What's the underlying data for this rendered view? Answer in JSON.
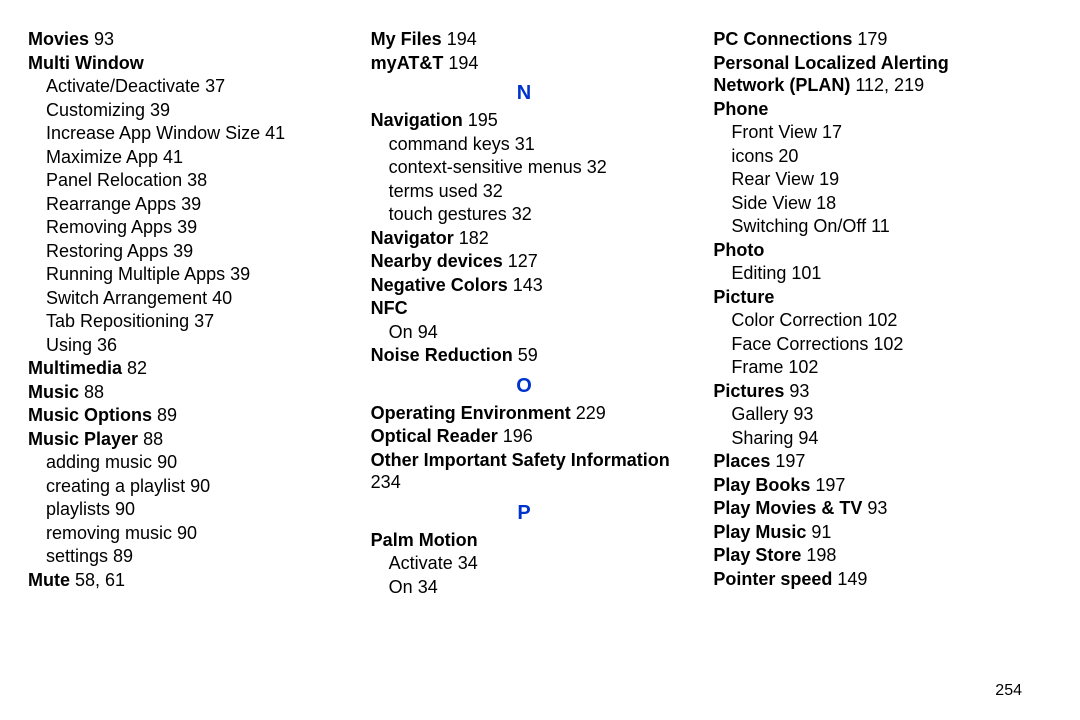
{
  "page_number": "254",
  "columns": [
    {
      "items": [
        {
          "type": "entry",
          "bold": true,
          "label": "Movies",
          "pages": "93"
        },
        {
          "type": "entry",
          "bold": true,
          "label": "Multi Window",
          "pages": ""
        },
        {
          "type": "sub",
          "label": "Activate/Deactivate",
          "pages": "37"
        },
        {
          "type": "sub",
          "label": "Customizing",
          "pages": "39"
        },
        {
          "type": "sub",
          "label": "Increase App Window Size",
          "pages": "41"
        },
        {
          "type": "sub",
          "label": "Maximize App",
          "pages": "41"
        },
        {
          "type": "sub",
          "label": "Panel Relocation",
          "pages": "38"
        },
        {
          "type": "sub",
          "label": "Rearrange Apps",
          "pages": "39"
        },
        {
          "type": "sub",
          "label": "Removing Apps",
          "pages": "39"
        },
        {
          "type": "sub",
          "label": "Restoring Apps",
          "pages": "39"
        },
        {
          "type": "sub",
          "label": "Running Multiple Apps",
          "pages": "39"
        },
        {
          "type": "sub",
          "label": "Switch Arrangement",
          "pages": "40"
        },
        {
          "type": "sub",
          "label": "Tab Repositioning",
          "pages": "37"
        },
        {
          "type": "sub",
          "label": "Using",
          "pages": "36"
        },
        {
          "type": "entry",
          "bold": true,
          "label": "Multimedia",
          "pages": "82"
        },
        {
          "type": "entry",
          "bold": true,
          "label": "Music",
          "pages": "88"
        },
        {
          "type": "entry",
          "bold": true,
          "label": "Music Options",
          "pages": "89"
        },
        {
          "type": "entry",
          "bold": true,
          "label": "Music Player",
          "pages": "88"
        },
        {
          "type": "sub",
          "label": "adding music",
          "pages": "90"
        },
        {
          "type": "sub",
          "label": "creating a playlist",
          "pages": "90"
        },
        {
          "type": "sub",
          "label": "playlists",
          "pages": "90"
        },
        {
          "type": "sub",
          "label": "removing music",
          "pages": "90"
        },
        {
          "type": "sub",
          "label": "settings",
          "pages": "89"
        },
        {
          "type": "entry",
          "bold": true,
          "label": "Mute",
          "pages": "58, 61"
        }
      ]
    },
    {
      "items": [
        {
          "type": "entry",
          "bold": true,
          "label": "My Files",
          "pages": "194"
        },
        {
          "type": "entry",
          "bold": true,
          "label": "myAT&T",
          "pages": "194"
        },
        {
          "type": "letter",
          "text": "N"
        },
        {
          "type": "entry",
          "bold": true,
          "label": "Navigation",
          "pages": "195"
        },
        {
          "type": "sub",
          "label": "command keys",
          "pages": "31"
        },
        {
          "type": "sub",
          "label": "context-sensitive menus",
          "pages": "32"
        },
        {
          "type": "sub",
          "label": "terms used",
          "pages": "32"
        },
        {
          "type": "sub",
          "label": "touch gestures",
          "pages": "32"
        },
        {
          "type": "entry",
          "bold": true,
          "label": "Navigator",
          "pages": "182"
        },
        {
          "type": "entry",
          "bold": true,
          "label": "Nearby devices",
          "pages": "127"
        },
        {
          "type": "entry",
          "bold": true,
          "label": "Negative Colors",
          "pages": "143"
        },
        {
          "type": "entry",
          "bold": true,
          "label": "NFC",
          "pages": ""
        },
        {
          "type": "sub",
          "label": "On",
          "pages": "94"
        },
        {
          "type": "entry",
          "bold": true,
          "label": "Noise Reduction",
          "pages": "59"
        },
        {
          "type": "letter",
          "text": "O"
        },
        {
          "type": "entry",
          "bold": true,
          "label": "Operating Environment",
          "pages": "229"
        },
        {
          "type": "entry",
          "bold": true,
          "label": "Optical Reader",
          "pages": "196"
        },
        {
          "type": "entry",
          "bold": true,
          "label": "Other Important Safety Information",
          "pages": "234"
        },
        {
          "type": "letter",
          "text": "P"
        },
        {
          "type": "entry",
          "bold": true,
          "label": "Palm Motion",
          "pages": ""
        },
        {
          "type": "sub",
          "label": "Activate",
          "pages": "34"
        },
        {
          "type": "sub",
          "label": "On",
          "pages": "34"
        }
      ]
    },
    {
      "items": [
        {
          "type": "entry",
          "bold": true,
          "label": "PC Connections",
          "pages": "179"
        },
        {
          "type": "entry",
          "bold": true,
          "label": "Personal Localized Alerting Network (PLAN)",
          "pages": "112, 219"
        },
        {
          "type": "entry",
          "bold": true,
          "label": "Phone",
          "pages": ""
        },
        {
          "type": "sub",
          "label": "Front View",
          "pages": "17"
        },
        {
          "type": "sub",
          "label": "icons",
          "pages": "20"
        },
        {
          "type": "sub",
          "label": "Rear View",
          "pages": "19"
        },
        {
          "type": "sub",
          "label": "Side View",
          "pages": "18"
        },
        {
          "type": "sub",
          "label": "Switching On/Off",
          "pages": "11"
        },
        {
          "type": "entry",
          "bold": true,
          "label": "Photo",
          "pages": ""
        },
        {
          "type": "sub",
          "label": "Editing",
          "pages": "101"
        },
        {
          "type": "entry",
          "bold": true,
          "label": "Picture",
          "pages": ""
        },
        {
          "type": "sub",
          "label": "Color Correction",
          "pages": "102"
        },
        {
          "type": "sub",
          "label": "Face Corrections",
          "pages": "102"
        },
        {
          "type": "sub",
          "label": "Frame",
          "pages": "102"
        },
        {
          "type": "entry",
          "bold": true,
          "label": "Pictures",
          "pages": "93"
        },
        {
          "type": "sub",
          "label": "Gallery",
          "pages": "93"
        },
        {
          "type": "sub",
          "label": "Sharing",
          "pages": "94"
        },
        {
          "type": "entry",
          "bold": true,
          "label": "Places",
          "pages": "197"
        },
        {
          "type": "entry",
          "bold": true,
          "label": "Play Books",
          "pages": "197"
        },
        {
          "type": "entry",
          "bold": true,
          "label": "Play Movies & TV",
          "pages": "93"
        },
        {
          "type": "entry",
          "bold": true,
          "label": "Play Music",
          "pages": "91"
        },
        {
          "type": "entry",
          "bold": true,
          "label": "Play Store",
          "pages": "198"
        },
        {
          "type": "entry",
          "bold": true,
          "label": "Pointer speed",
          "pages": "149"
        }
      ]
    }
  ]
}
